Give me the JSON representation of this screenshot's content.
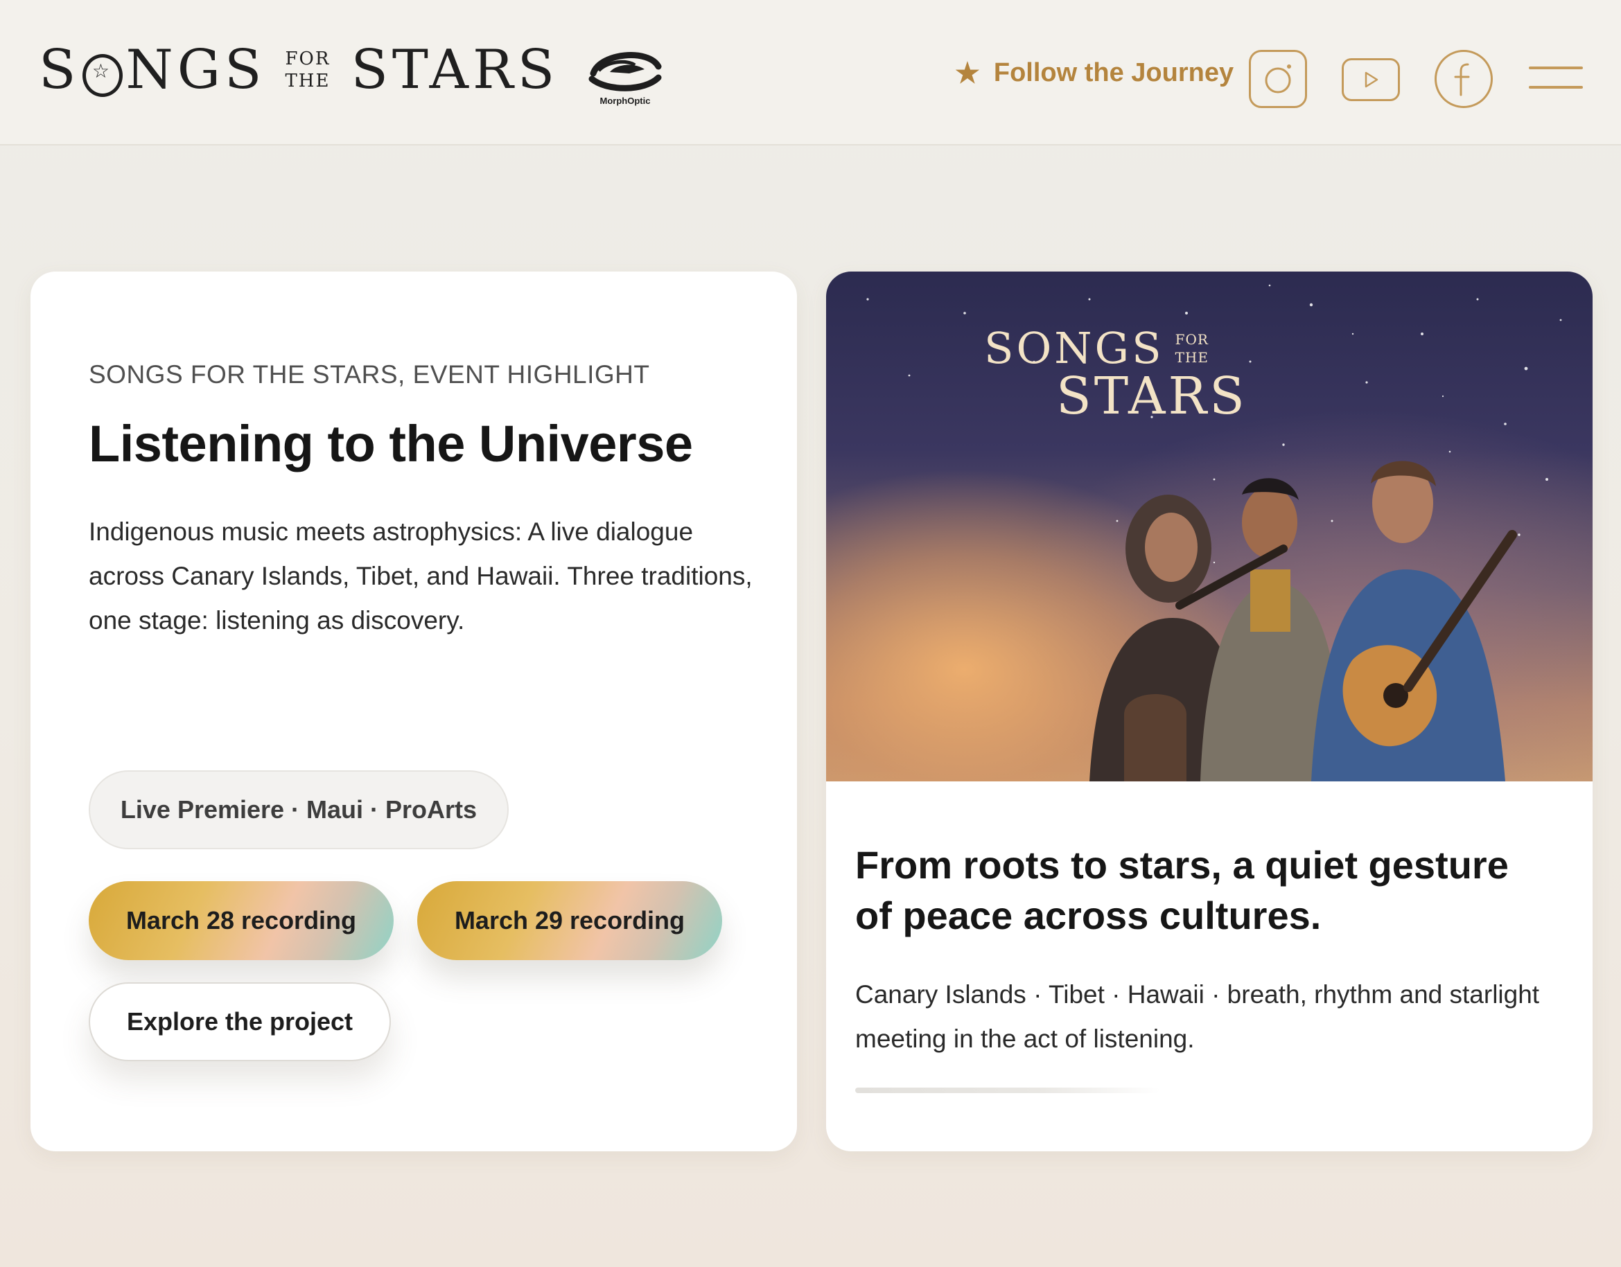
{
  "header": {
    "brand": {
      "word1_pre": "S",
      "word1_star": "☆",
      "word1_post": "NGS",
      "small_top": "FOR",
      "small_bottom": "THE",
      "word2": "STARS"
    },
    "partner_logo_label": "MorphOptic",
    "follow_label": "Follow the Journey",
    "follow_icon": "star-icon",
    "social_icons": [
      "instagram-icon",
      "youtube-icon",
      "facebook-icon"
    ],
    "menu_icon": "hamburger-menu-icon",
    "accent_color": "#b4843d"
  },
  "event_card": {
    "eyebrow": "SONGS FOR THE STARS, EVENT HIGHLIGHT",
    "title": "Listening to the Universe",
    "description": "Indigenous music meets astrophysics: A live dialogue across Canary Islands, Tibet, and Hawaii. Three traditions, one stage: listening as discovery.",
    "tag": "Live Premiere · Maui · ProArts",
    "recording_buttons": [
      "March 28 recording",
      "March 29 recording"
    ],
    "explore_button": "Explore the project"
  },
  "feature_card": {
    "image_logo": {
      "word1": "SONGS",
      "small_top": "FOR",
      "small_bottom": "THE",
      "word2": "STARS"
    },
    "quote": "From roots to stars, a quiet gesture of peace across cultures.",
    "subtitle": "Canary Islands · Tibet · Hawaii · breath, rhythm and starlight meeting in the act of listening.",
    "progress": 0.4
  }
}
